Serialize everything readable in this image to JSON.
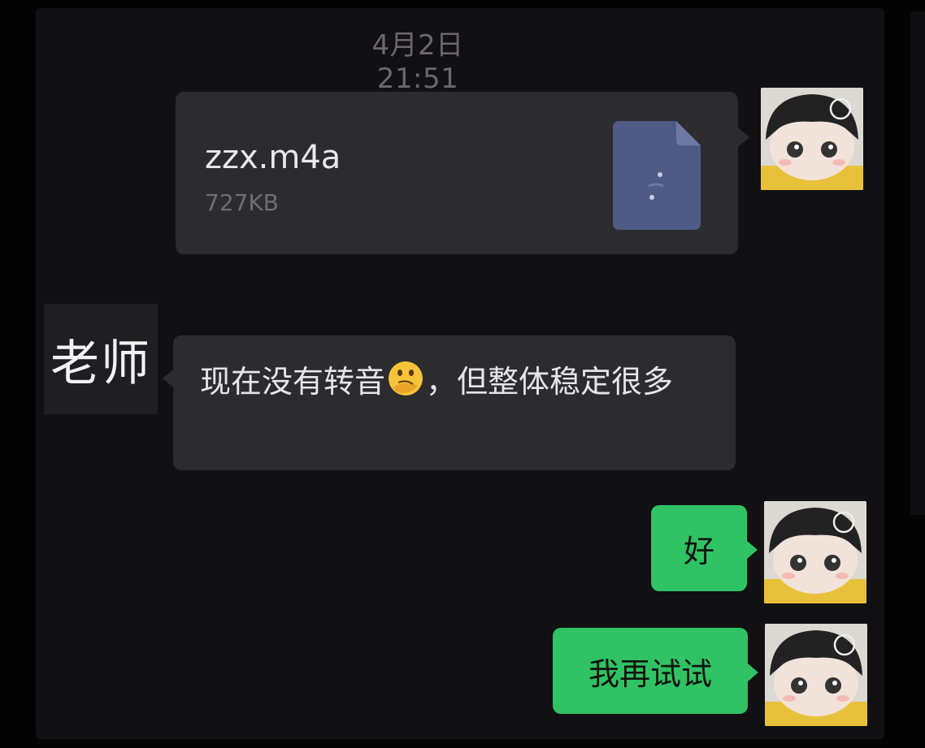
{
  "timestamp": "4月2日 21:51",
  "messages": {
    "file": {
      "name": "zzx.m4a",
      "size": "727KB",
      "icon": "audio-file-icon"
    },
    "incoming": {
      "sender": "老师",
      "text_before": "现在没有转音",
      "emoji": "thinking-face-emoji",
      "text_after": "，但整体稳定很多"
    },
    "reply1": {
      "text": "好"
    },
    "reply2": {
      "text": "我再试试"
    }
  },
  "colors": {
    "background": "#030303",
    "panel": "#111012",
    "bubble_incoming": "#2c2b2e",
    "bubble_outgoing": "#2fc363",
    "file_icon": "#4f5a86"
  }
}
